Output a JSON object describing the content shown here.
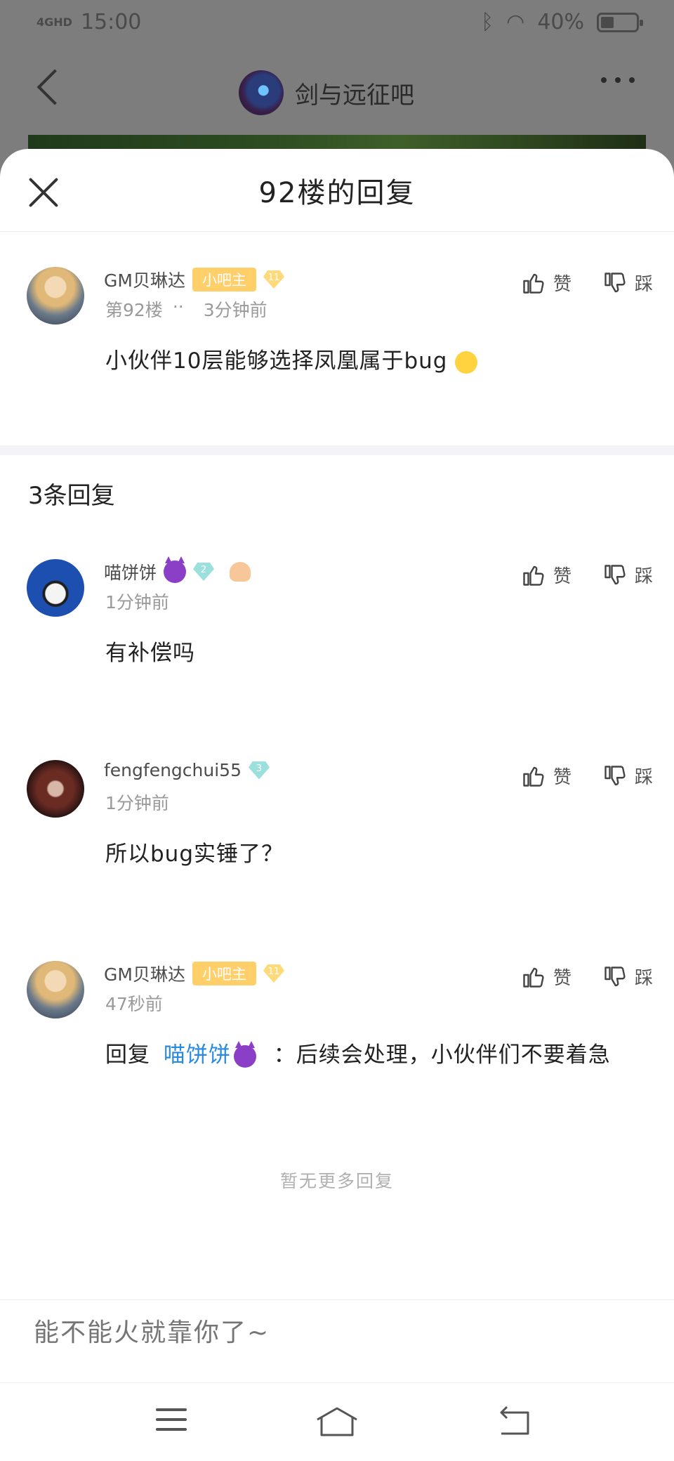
{
  "status_bar": {
    "network": "4GHD",
    "time": "15:00",
    "battery": "40%"
  },
  "background_app": {
    "forum_name": "剑与远征吧"
  },
  "sheet": {
    "title": "92楼的回复"
  },
  "main_post": {
    "user": "GM贝琳达",
    "role_badge": "小吧主",
    "level": "11",
    "floor": "第92楼",
    "dots": "··",
    "time": "3分钟前",
    "content": "小伙伴10层能够选择凤凰属于bug",
    "like_label": "赞",
    "dislike_label": "踩"
  },
  "replies_header": "3条回复",
  "replies": [
    {
      "user": "喵饼饼",
      "level": "2",
      "time": "1分钟前",
      "content": "有补偿吗",
      "like_label": "赞",
      "dislike_label": "踩"
    },
    {
      "user": "fengfengchui55",
      "level": "3",
      "time": "1分钟前",
      "content": "所以bug实锤了？",
      "like_label": "赞",
      "dislike_label": "踩"
    },
    {
      "user": "GM贝琳达",
      "role_badge": "小吧主",
      "level": "11",
      "time": "47秒前",
      "content_prefix": "回复",
      "mention": "喵饼饼",
      "content_suffix": "：后续会处理，小伙伴们不要着急",
      "like_label": "赞",
      "dislike_label": "踩"
    }
  ],
  "no_more": "暂无更多回复",
  "input": {
    "placeholder": "能不能火就靠你了~"
  },
  "colors": {
    "accent": "#2a8ae0",
    "badge": "#ffcf6a"
  }
}
